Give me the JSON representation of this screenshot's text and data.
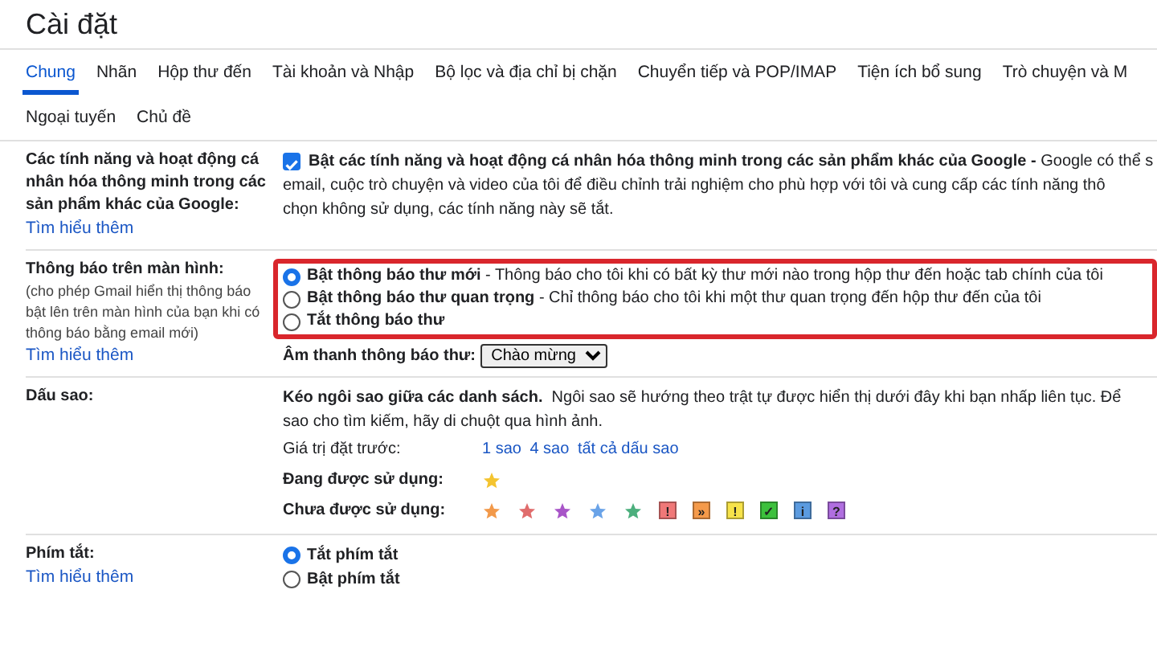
{
  "title": "Cài đặt",
  "tabs": [
    {
      "label": "Chung",
      "selected": true
    },
    {
      "label": "Nhãn",
      "selected": false
    },
    {
      "label": "Hộp thư đến",
      "selected": false
    },
    {
      "label": "Tài khoản và Nhập",
      "selected": false
    },
    {
      "label": "Bộ lọc và địa chỉ bị chặn",
      "selected": false
    },
    {
      "label": "Chuyển tiếp và POP/IMAP",
      "selected": false
    },
    {
      "label": "Tiện ích bổ sung",
      "selected": false
    },
    {
      "label": "Trò chuyện và M",
      "selected": false
    },
    {
      "label": "Ngoại tuyến",
      "selected": false
    },
    {
      "label": "Chủ đề",
      "selected": false
    }
  ],
  "smart_features": {
    "label": "Các tính năng và hoạt động cá nhân hóa thông minh trong các sản phẩm khác của Google:",
    "link": "Tìm hiểu thêm",
    "checked": true,
    "lines": [
      "**Bật các tính năng và hoạt động cá nhân hóa thông minh trong các sản phẩm khác của Google -** Google có thể s",
      "email, cuộc trò chuyện và video của tôi để điều chỉnh trải nghiệm cho phù hợp với tôi và cung cấp các tính năng thô",
      "chọn không sử dụng, các tính năng này sẽ tắt."
    ]
  },
  "desktop_notifications": {
    "label": "Thông báo trên màn hình:",
    "hint": "(cho phép Gmail hiển thị thông báo bật lên trên màn hình của bạn khi có thông báo bằng email mới)",
    "link": "Tìm hiểu thêm",
    "highlighted": true,
    "options": [
      {
        "text": "**Bật thông báo thư mới** - Thông báo cho tôi khi có bất kỳ thư mới nào trong hộp thư đến hoặc tab chính của tôi",
        "selected": true
      },
      {
        "text": "**Bật thông báo thư quan trọng** - Chỉ thông báo cho tôi khi một thư quan trọng đến hộp thư đến của tôi",
        "selected": false
      },
      {
        "text": "**Tắt thông báo thư**",
        "selected": false
      }
    ],
    "sound_label": "Âm thanh thông báo thư:",
    "sound_value": "Chào mừng"
  },
  "stars": {
    "label": "Dấu sao:",
    "lines": [
      "**Kéo ngôi sao giữa các danh sách.**  Ngôi sao sẽ hướng theo trật tự được hiển thị dưới đây khi bạn nhấp liên tục. Để",
      "sao cho tìm kiếm, hãy di chuột qua hình ảnh."
    ],
    "presets_label": "Giá trị đặt trước:",
    "presets": [
      "1 sao",
      "4 sao",
      "tất cả dấu sao"
    ],
    "in_use_label": "Đang được sử dụng:",
    "in_use": [
      {
        "kind": "star",
        "color": "#f4c430"
      }
    ],
    "not_in_use_label": "Chưa được sử dụng:",
    "not_in_use": [
      {
        "kind": "star",
        "color": "#f2994a"
      },
      {
        "kind": "star",
        "color": "#e06c6c"
      },
      {
        "kind": "star",
        "color": "#a855c8"
      },
      {
        "kind": "star",
        "color": "#6aa3e8"
      },
      {
        "kind": "star",
        "color": "#4caf7d"
      },
      {
        "kind": "square",
        "color": "#f07878",
        "glyph": "!"
      },
      {
        "kind": "square",
        "color": "#f59a4a",
        "glyph": "»"
      },
      {
        "kind": "square",
        "color": "#f7e34a",
        "glyph": "!"
      },
      {
        "kind": "square",
        "color": "#3cc13c",
        "glyph": "✓"
      },
      {
        "kind": "square",
        "color": "#5b9be0",
        "glyph": "i"
      },
      {
        "kind": "square",
        "color": "#b06ee0",
        "glyph": "?"
      }
    ]
  },
  "shortcuts": {
    "label": "Phím tắt:",
    "link": "Tìm hiểu thêm",
    "options": [
      {
        "text": "Tắt phím tắt",
        "selected": true
      },
      {
        "text": "Bật phím tắt",
        "selected": false
      }
    ]
  }
}
